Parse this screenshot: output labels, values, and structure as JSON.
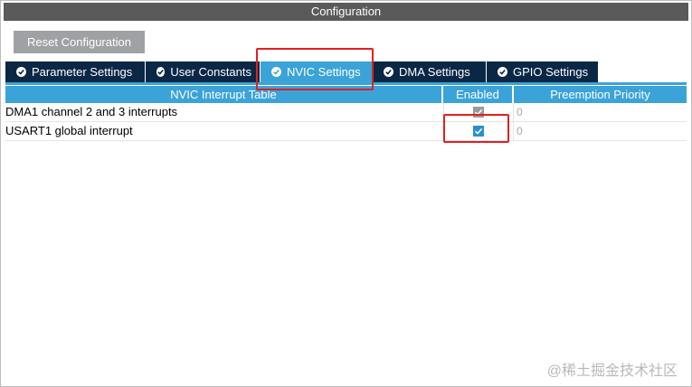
{
  "window": {
    "title": "Configuration"
  },
  "toolbar": {
    "reset_label": "Reset Configuration"
  },
  "tabs": [
    {
      "label": "Parameter Settings",
      "icon": "check-circle-icon",
      "active": false
    },
    {
      "label": "User Constants",
      "icon": "check-circle-icon",
      "active": false
    },
    {
      "label": "NVIC Settings",
      "icon": "check-circle-icon",
      "active": true
    },
    {
      "label": "DMA Settings",
      "icon": "check-circle-icon",
      "active": false
    },
    {
      "label": "GPIO Settings",
      "icon": "check-circle-icon",
      "active": false
    }
  ],
  "table": {
    "headers": [
      "NVIC Interrupt Table",
      "Enabled",
      "Preemption Priority"
    ],
    "rows": [
      {
        "name": "DMA1 channel 2 and 3 interrupts",
        "enabled": true,
        "editable": false,
        "priority": "0"
      },
      {
        "name": "USART1 global interrupt",
        "enabled": true,
        "editable": true,
        "priority": "0"
      }
    ]
  },
  "watermark": "@稀土掘金技术社区",
  "colors": {
    "tab_bg": "#0b2746",
    "tab_active": "#3ba3d8",
    "title_bg": "#5a5a5a",
    "highlight": "#e02020"
  }
}
